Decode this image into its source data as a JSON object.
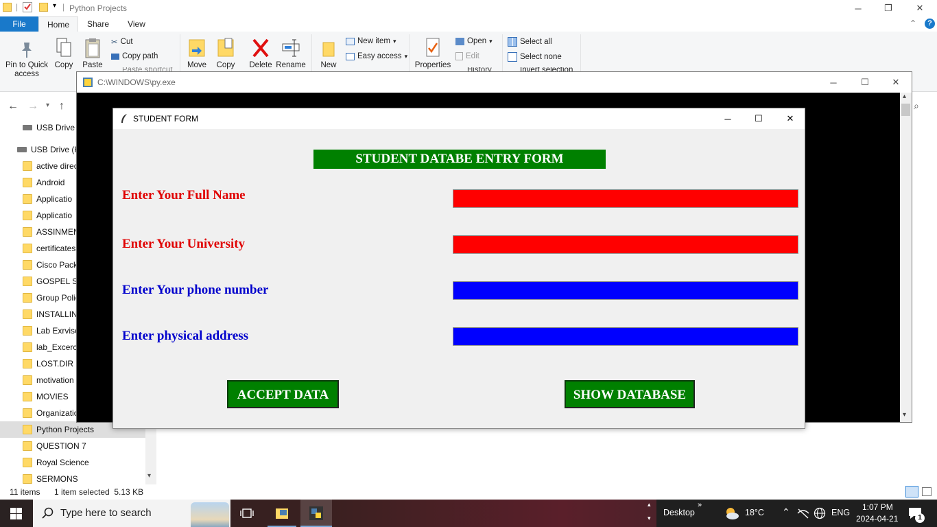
{
  "explorer": {
    "title": "Python Projects",
    "tabs": {
      "file": "File",
      "home": "Home",
      "share": "Share",
      "view": "View"
    },
    "ribbon": {
      "pin": "Pin to Quick access",
      "copy": "Copy",
      "paste": "Paste",
      "cut": "Cut",
      "copy_path": "Copy path",
      "paste_shortcut": "Paste shortcut",
      "move": "Move",
      "copy_to": "Copy",
      "delete": "Delete",
      "rename": "Rename",
      "new": "New",
      "new_item": "New item",
      "easy_access": "Easy access",
      "properties": "Properties",
      "open": "Open",
      "edit": "Edit",
      "history": "History",
      "select_all": "Select all",
      "select_none": "Select none",
      "invert_selection": "Invert selection"
    },
    "sidebar": [
      {
        "label": "USB Drive (",
        "type": "drive"
      },
      {
        "label": "USB Drive (H",
        "type": "drive"
      },
      {
        "label": "active direc",
        "type": "folder"
      },
      {
        "label": "Android",
        "type": "folder"
      },
      {
        "label": "Applicatio",
        "type": "folder"
      },
      {
        "label": "Applicatio",
        "type": "folder"
      },
      {
        "label": "ASSINMEN",
        "type": "folder"
      },
      {
        "label": "certificates",
        "type": "folder"
      },
      {
        "label": "Cisco Pack",
        "type": "folder"
      },
      {
        "label": "GOSPEL SO",
        "type": "folder"
      },
      {
        "label": "Group Polic",
        "type": "folder"
      },
      {
        "label": "INSTALLING",
        "type": "folder"
      },
      {
        "label": "Lab Exrvise",
        "type": "folder"
      },
      {
        "label": "lab_Excerci",
        "type": "folder"
      },
      {
        "label": "LOST.DIR",
        "type": "folder"
      },
      {
        "label": "motivation",
        "type": "folder"
      },
      {
        "label": "MOVIES",
        "type": "folder"
      },
      {
        "label": "Organizatio",
        "type": "folder"
      },
      {
        "label": "Python Projects",
        "type": "folder",
        "selected": true
      },
      {
        "label": "QUESTION 7",
        "type": "folder"
      },
      {
        "label": "Royal Science",
        "type": "folder"
      },
      {
        "label": "SERMONS",
        "type": "folder"
      }
    ],
    "status": {
      "items": "11 items",
      "selected": "1 item selected  5.13 KB"
    }
  },
  "console": {
    "title": "C:\\WINDOWS\\py.exe"
  },
  "form": {
    "title": "STUDENT FORM",
    "heading": "STUDENT DATABE ENTRY FORM",
    "fields": [
      {
        "label": "Enter Your Full Name",
        "label_color": "#e00000",
        "entry_color": "#ff0000",
        "value": ""
      },
      {
        "label": "Enter Your University",
        "label_color": "#e00000",
        "entry_color": "#ff0000",
        "value": ""
      },
      {
        "label": "Enter Your phone number",
        "label_color": "#0000cc",
        "entry_color": "#0000ff",
        "value": ""
      },
      {
        "label": "Enter physical address",
        "label_color": "#0000cc",
        "entry_color": "#0000ff",
        "value": ""
      }
    ],
    "accept_button": "ACCEPT  DATA",
    "show_button": "SHOW DATABASE"
  },
  "taskbar": {
    "search_placeholder": "Type here to search",
    "desktop": "Desktop",
    "temperature": "18°C",
    "language": "ENG",
    "time": "1:07 PM",
    "date": "2024-04-21",
    "notifications": "1"
  },
  "colors": {
    "accent": "#1979ca",
    "heading_bg": "#008000"
  }
}
